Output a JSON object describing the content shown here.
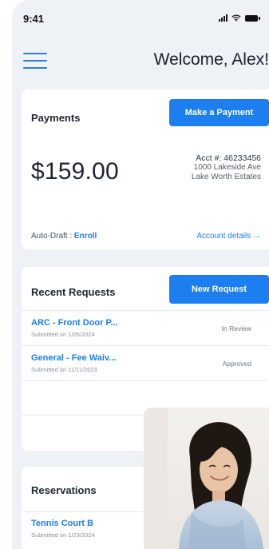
{
  "status_bar": {
    "time": "9:41"
  },
  "header": {
    "welcome": "Welcome, Alex!"
  },
  "payments": {
    "title": "Payments",
    "make_payment_label": "Make a Payment",
    "amount": "$159.00",
    "account_number": "Acct #: 46233456",
    "address_line1": "1000 Lakeside Ave",
    "address_line2": "Lake Worth Estates",
    "autodraft_label": "Auto-Draft :",
    "autodraft_link": "Enroll",
    "account_details_label": "Account details →"
  },
  "requests": {
    "title": "Recent Requests",
    "new_request_label": "New Request",
    "items": [
      {
        "title": "ARC - Front Door P...",
        "submitted": "Submitted on 1/05/2024",
        "status": "In Review"
      },
      {
        "title": "General - Fee Waiv...",
        "submitted": "Submitted on 11/11/2023",
        "status": "Approved"
      }
    ]
  },
  "reservations": {
    "title": "Reservations",
    "items": [
      {
        "title": "Tennis Court B",
        "submitted": "Submitted on 1/23/2024"
      }
    ]
  },
  "colors": {
    "accent": "#1d7ef0",
    "background": "#eef1f5",
    "card": "#ffffff"
  },
  "icons": [
    "signal-icon",
    "wifi-icon",
    "battery-icon",
    "hamburger-menu-icon",
    "arrow-right-icon"
  ]
}
